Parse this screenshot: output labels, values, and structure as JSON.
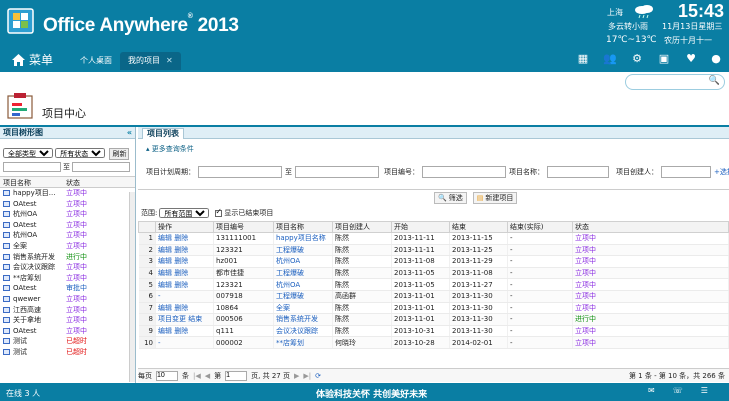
{
  "app": {
    "title": "Office Anywhere",
    "version": "2013"
  },
  "weather": {
    "city": "上海",
    "desc": "多云转小雨",
    "temp": "17℃~13℃"
  },
  "clock": {
    "time": "15:43",
    "date": "11月13日星期三",
    "lunar": "农历十月十一"
  },
  "topnav": {
    "menu_label": "菜单",
    "tabs": [
      {
        "label": "个人桌面"
      },
      {
        "label": "我的项目"
      }
    ]
  },
  "page": {
    "title": "项目中心"
  },
  "left": {
    "heading": "项目树形图",
    "type_select": "全部类型",
    "status_select": "所有状态",
    "refresh": "刷新",
    "to": "至",
    "col_name": "项目名称",
    "col_status": "状态",
    "items": [
      {
        "name": "happy项目...",
        "status": "立项中",
        "color": "purple"
      },
      {
        "name": "OAtest",
        "status": "立项中",
        "color": "purple"
      },
      {
        "name": "杭州OA",
        "status": "立项中",
        "color": "purple"
      },
      {
        "name": "OAtest",
        "status": "立项中",
        "color": "purple"
      },
      {
        "name": "杭州OA",
        "status": "立项中",
        "color": "purple"
      },
      {
        "name": "全案",
        "status": "立项中",
        "color": "purple"
      },
      {
        "name": "销售系统开发",
        "status": "进行中",
        "color": "green"
      },
      {
        "name": "会议决议跟踪",
        "status": "立项中",
        "color": "purple"
      },
      {
        "name": "**店筹划",
        "status": "立项中",
        "color": "purple"
      },
      {
        "name": "OAtest",
        "status": "审批中",
        "color": "blue"
      },
      {
        "name": "qwewer",
        "status": "立项中",
        "color": "purple"
      },
      {
        "name": "江西高速",
        "status": "立项中",
        "color": "purple"
      },
      {
        "name": "关于拿地",
        "status": "立项中",
        "color": "purple"
      },
      {
        "name": "OAtest",
        "status": "立项中",
        "color": "purple"
      },
      {
        "name": "测试",
        "status": "已超时",
        "color": "red"
      },
      {
        "name": "测试",
        "status": "已超时",
        "color": "red"
      }
    ]
  },
  "right": {
    "tab": "项目列表",
    "more_cond": "更多查询条件",
    "cond": {
      "period": "项目计划周期：",
      "to": "至",
      "code": "项目编号：",
      "name": "项目名称：",
      "creator": "项目创建人：",
      "select": "选择"
    },
    "filter_btn": "筛选",
    "new_btn": "新建项目",
    "scope_label": "范围:",
    "scope_value": "所有范围",
    "show_closed": "显示已结束项目",
    "columns": [
      "",
      "操作",
      "项目编号",
      "项目名称",
      "项目创建人",
      "开始",
      "结束",
      "结束(实际)",
      "状态"
    ],
    "rows": [
      {
        "n": "1",
        "ops": "编辑 删除",
        "code": "131111001",
        "name": "happy项目名称",
        "creator": "陈然",
        "start": "2013-11-11",
        "end": "2013-11-15",
        "actual": "-",
        "status": "立项中",
        "color": "purple"
      },
      {
        "n": "2",
        "ops": "编辑 删除",
        "code": "123321",
        "name": "工程爆破",
        "creator": "陈然",
        "start": "2013-11-11",
        "end": "2013-11-25",
        "actual": "-",
        "status": "立项中",
        "color": "purple"
      },
      {
        "n": "3",
        "ops": "编辑 删除",
        "code": "hz001",
        "name": "杭州OA",
        "creator": "陈然",
        "start": "2013-11-08",
        "end": "2013-11-29",
        "actual": "-",
        "status": "立项中",
        "color": "purple"
      },
      {
        "n": "4",
        "ops": "编辑 删除",
        "code": "都市佳捷",
        "name": "工程爆破",
        "creator": "陈然",
        "start": "2013-11-05",
        "end": "2013-11-08",
        "actual": "-",
        "status": "立项中",
        "color": "purple"
      },
      {
        "n": "5",
        "ops": "编辑 删除",
        "code": "123321",
        "name": "杭州OA",
        "creator": "陈然",
        "start": "2013-11-05",
        "end": "2013-11-27",
        "actual": "-",
        "status": "立项中",
        "color": "purple"
      },
      {
        "n": "6",
        "ops": "-",
        "code": "007918",
        "name": "工程爆破",
        "creator": "高函群",
        "start": "2013-11-01",
        "end": "2013-11-30",
        "actual": "-",
        "status": "立项中",
        "color": "purple"
      },
      {
        "n": "7",
        "ops": "编辑 删除",
        "code": "10864",
        "name": "全案",
        "creator": "陈然",
        "start": "2013-11-01",
        "end": "2013-11-30",
        "actual": "-",
        "status": "立项中",
        "color": "purple"
      },
      {
        "n": "8",
        "ops": "项目变更 结束",
        "code": "000506",
        "name": "销售系统开发",
        "creator": "陈然",
        "start": "2013-11-01",
        "end": "2013-11-30",
        "actual": "-",
        "status": "进行中",
        "color": "green"
      },
      {
        "n": "9",
        "ops": "编辑 删除",
        "code": "q111",
        "name": "会议决议跟踪",
        "creator": "陈然",
        "start": "2013-10-31",
        "end": "2013-11-30",
        "actual": "-",
        "status": "立项中",
        "color": "purple"
      },
      {
        "n": "10",
        "ops": "-",
        "code": "000002",
        "name": "**店筹划",
        "creator": "何晓玲",
        "start": "2013-10-28",
        "end": "2014-02-01",
        "actual": "-",
        "status": "立项中",
        "color": "purple"
      }
    ],
    "pager": {
      "per_page_label": "每页",
      "per_page": "10",
      "unit": "条",
      "page_label": "第",
      "page": "1",
      "page_of": "页, 共 27 页",
      "summary": "第 1 条 - 第 10 条，共 266 条"
    }
  },
  "footer": {
    "online": "在线  3  人",
    "slogan": "体验科技关怀  共创美好未来"
  }
}
